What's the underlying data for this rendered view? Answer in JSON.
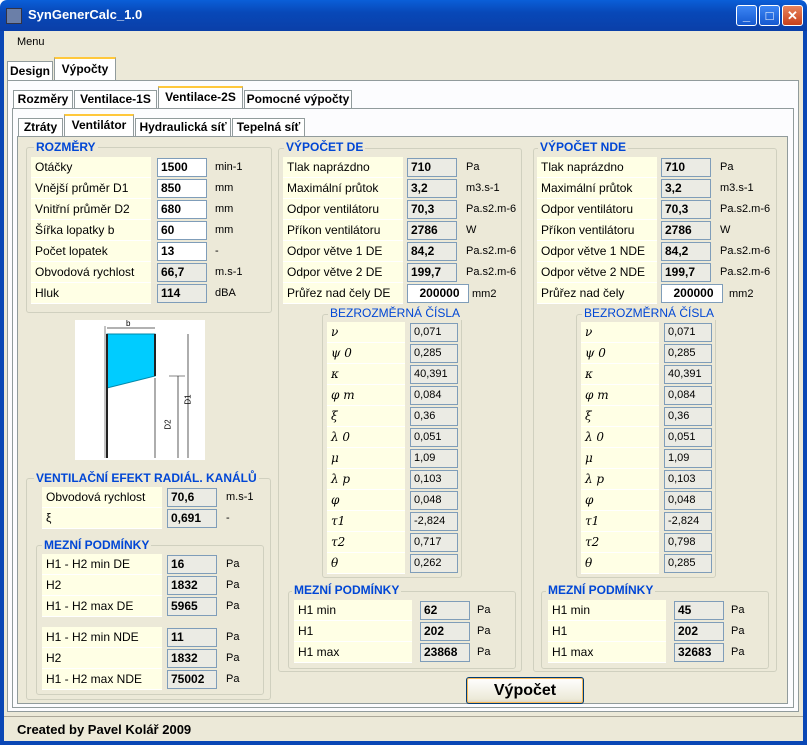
{
  "window": {
    "title": "SynGenerCalc_1.0",
    "min": "_",
    "max": "□",
    "close": "✕"
  },
  "menu": {
    "label": "Menu"
  },
  "top_tabs": [
    "Design",
    "Výpočty"
  ],
  "sub_tabs": [
    "Rozměry",
    "Ventilace-1S",
    "Ventilace-2S",
    "Pomocné výpočty"
  ],
  "sub_sub_tabs": [
    "Ztráty",
    "Ventilátor",
    "Hydraulická síť",
    "Tepelná síť"
  ],
  "rozmery": {
    "title": "ROZMĚRY",
    "rows": [
      {
        "label": "Otáčky",
        "value": "1500",
        "unit": "min-1",
        "editable": true
      },
      {
        "label": "Vnější průměr  D1",
        "value": "850",
        "unit": "mm",
        "editable": true
      },
      {
        "label": "Vnitřní průměr  D2",
        "value": "680",
        "unit": "mm",
        "editable": true
      },
      {
        "label": "Šířka lopatky    b",
        "value": "60",
        "unit": "mm",
        "editable": true
      },
      {
        "label": "Počet lopatek",
        "value": "13",
        "unit": "-",
        "editable": true
      },
      {
        "label": "Obvodová rychlost",
        "value": "66,7",
        "unit": "m.s-1",
        "editable": false
      },
      {
        "label": "Hluk",
        "value": "114",
        "unit": "dBA",
        "editable": false
      }
    ]
  },
  "figure": {
    "b": "b",
    "d2": "D2",
    "d1": "D1"
  },
  "efekt": {
    "title": "VENTILAČNÍ EFEKT RADIÁL. KANÁLŮ",
    "rows": [
      {
        "label": "Obvodová rychlost",
        "value": "70,6",
        "unit": "m.s-1"
      },
      {
        "label": "ξ",
        "value": "0,691",
        "unit": "-"
      }
    ]
  },
  "mezni_left": {
    "title": "MEZNÍ PODMÍNKY",
    "rows": [
      {
        "label": "H1 - H2 min DE",
        "value": "16",
        "unit": "Pa"
      },
      {
        "label": "H2",
        "value": "1832",
        "unit": "Pa"
      },
      {
        "label": "H1 - H2 max DE",
        "value": "5965",
        "unit": "Pa"
      },
      {
        "label": "H1 - H2 min NDE",
        "value": "11",
        "unit": "Pa"
      },
      {
        "label": "H2",
        "value": "1832",
        "unit": "Pa"
      },
      {
        "label": "H1 - H2 max NDE",
        "value": "75002",
        "unit": "Pa"
      }
    ]
  },
  "de": {
    "title": "VÝPOČET DE",
    "rows": [
      {
        "label": "Tlak naprázdno",
        "value": "710",
        "unit": "Pa"
      },
      {
        "label": "Maximální průtok",
        "value": "3,2",
        "unit": "m3.s-1"
      },
      {
        "label": "Odpor ventilátoru",
        "value": "70,3",
        "unit": "Pa.s2.m-6"
      },
      {
        "label": "Příkon ventilátoru",
        "value": "2786",
        "unit": "W"
      },
      {
        "label": "Odpor větve 1 DE",
        "value": "84,2",
        "unit": "Pa.s2.m-6"
      },
      {
        "label": "Odpor větve 2 DE",
        "value": "199,7",
        "unit": "Pa.s2.m-6"
      }
    ],
    "prurez": {
      "label": "Průřez nad čely DE",
      "value": "200000",
      "unit": "mm2"
    },
    "bez_title": "BEZROZMĚRNÁ ČÍSLA",
    "bez": [
      {
        "s": "ν",
        "v": "0,071"
      },
      {
        "s": "ψ 0",
        "v": "0,285"
      },
      {
        "s": "κ",
        "v": "40,391"
      },
      {
        "s": "φ m",
        "v": "0,084"
      },
      {
        "s": "ξ",
        "v": "0,36"
      },
      {
        "s": "λ 0",
        "v": "0,051"
      },
      {
        "s": "μ",
        "v": "1,09"
      },
      {
        "s": "λ p",
        "v": "0,103"
      },
      {
        "s": "φ",
        "v": "0,048"
      },
      {
        "s": "τ1",
        "v": "-2,824"
      },
      {
        "s": "τ2",
        "v": "0,717"
      },
      {
        "s": "θ",
        "v": "0,262"
      }
    ],
    "mezni_title": "MEZNÍ PODMÍNKY",
    "mezni": [
      {
        "label": "H1 min",
        "value": "62",
        "unit": "Pa"
      },
      {
        "label": "H1",
        "value": "202",
        "unit": "Pa"
      },
      {
        "label": "H1 max",
        "value": "23868",
        "unit": "Pa"
      }
    ]
  },
  "nde": {
    "title": "VÝPOČET NDE",
    "rows": [
      {
        "label": "Tlak naprázdno",
        "value": "710",
        "unit": "Pa"
      },
      {
        "label": "Maximální průtok",
        "value": "3,2",
        "unit": "m3.s-1"
      },
      {
        "label": "Odpor ventilátoru",
        "value": "70,3",
        "unit": "Pa.s2.m-6"
      },
      {
        "label": "Příkon ventilátoru",
        "value": "2786",
        "unit": "W"
      },
      {
        "label": "Odpor větve 1 NDE",
        "value": "84,2",
        "unit": "Pa.s2.m-6"
      },
      {
        "label": "Odpor větve 2 NDE",
        "value": "199,7",
        "unit": "Pa.s2.m-6"
      }
    ],
    "prurez": {
      "label": "Průřez nad čely",
      "value": "200000",
      "unit": "mm2"
    },
    "bez_title": "BEZROZMĚRNÁ ČÍSLA",
    "bez": [
      {
        "s": "ν",
        "v": "0,071"
      },
      {
        "s": "ψ 0",
        "v": "0,285"
      },
      {
        "s": "κ",
        "v": "40,391"
      },
      {
        "s": "φ m",
        "v": "0,084"
      },
      {
        "s": "ξ",
        "v": "0,36"
      },
      {
        "s": "λ 0",
        "v": "0,051"
      },
      {
        "s": "μ",
        "v": "1,09"
      },
      {
        "s": "λ p",
        "v": "0,103"
      },
      {
        "s": "φ",
        "v": "0,048"
      },
      {
        "s": "τ1",
        "v": "-2,824"
      },
      {
        "s": "τ2",
        "v": "0,798"
      },
      {
        "s": "θ",
        "v": "0,285"
      }
    ],
    "mezni_title": "MEZNÍ PODMÍNKY",
    "mezni": [
      {
        "label": "H1 min",
        "value": "45",
        "unit": "Pa"
      },
      {
        "label": "H1",
        "value": "202",
        "unit": "Pa"
      },
      {
        "label": "H1 max",
        "value": "32683",
        "unit": "Pa"
      }
    ]
  },
  "calc_button": "Výpočet",
  "status": "Created by Pavel Kolář 2009"
}
